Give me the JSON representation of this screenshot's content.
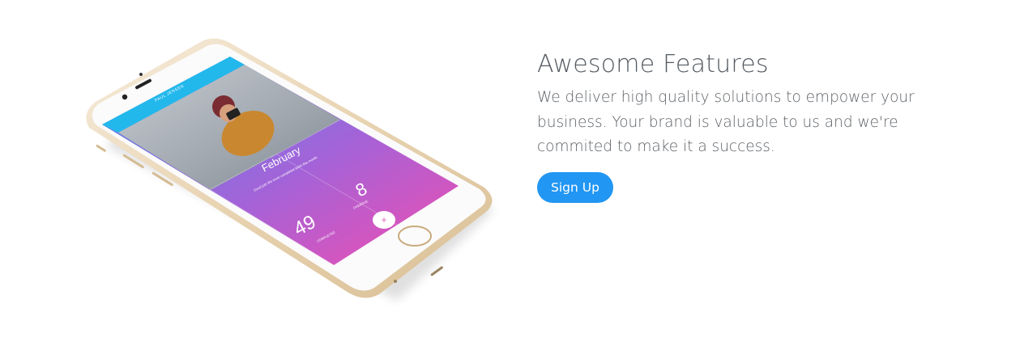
{
  "feature": {
    "title": "Awesome Features",
    "description": "We deliver high quality solutions to empower your business. Your brand is valuable to us and we're commited to make it a success.",
    "button_label": "Sign Up"
  },
  "phone_screen": {
    "header_name": "PAUL JENSEN",
    "month": "February",
    "tagline": "Good job! 9% more completed tasks this month.",
    "completed_value": "49",
    "completed_label": "COMPLETED",
    "overdue_value": "8",
    "overdue_label": "OVERDUE",
    "add_symbol": "+"
  },
  "colors": {
    "accent": "#2196f3",
    "screen_header": "#22b8ec",
    "gradient_start": "#5b8ee6",
    "gradient_end": "#f04fb0",
    "phone_body": "#eed9b8"
  },
  "icons": [
    "menu-icon",
    "add-icon",
    "home-button-icon",
    "camera-icon",
    "speaker-icon"
  ]
}
